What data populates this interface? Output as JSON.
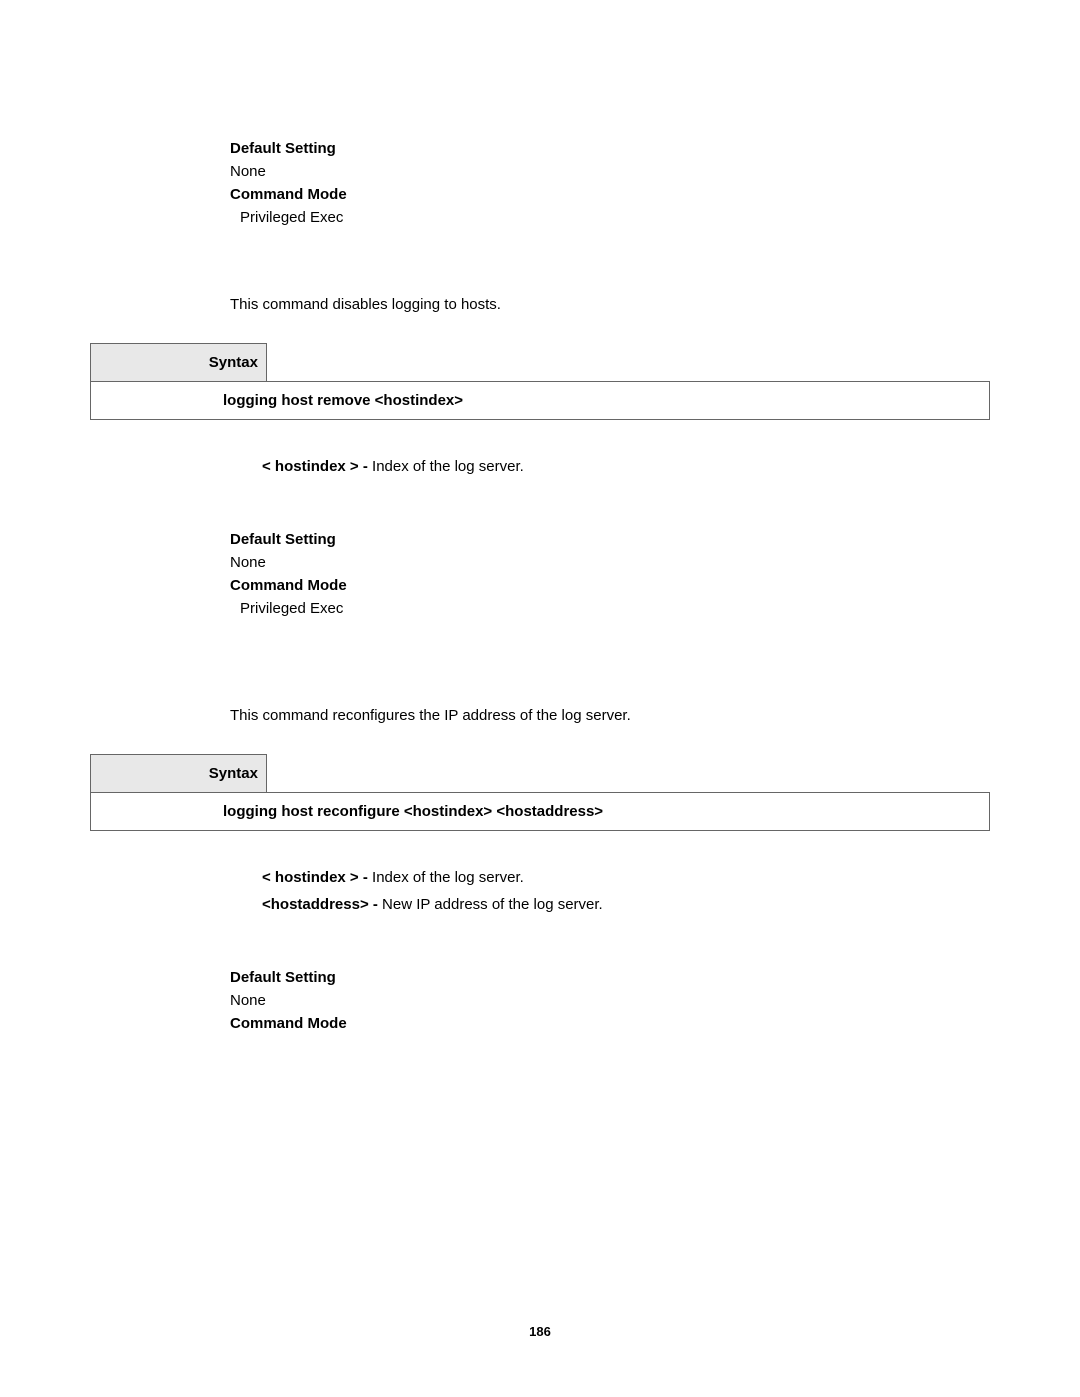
{
  "section1": {
    "default_setting_label": "Default Setting",
    "default_setting_value": "None",
    "command_mode_label": "Command Mode",
    "command_mode_value": "Privileged Exec"
  },
  "section2": {
    "description": "This command disables logging to hosts.",
    "syntax_label": "Syntax",
    "command": "logging host remove <hostindex>",
    "param1_name": "< hostindex > - ",
    "param1_desc": "Index of the log server.",
    "default_setting_label": "Default Setting",
    "default_setting_value": "None",
    "command_mode_label": "Command Mode",
    "command_mode_value": "Privileged Exec"
  },
  "section3": {
    "description": "This command reconfigures the IP address of the log server.",
    "syntax_label": "Syntax",
    "command": "logging host reconfigure <hostindex> <hostaddress>",
    "param1_name": "< hostindex > - ",
    "param1_desc": "Index of the log server.",
    "param2_name": "<hostaddress> - ",
    "param2_desc": "New IP address of the log server.",
    "default_setting_label": "Default Setting",
    "default_setting_value": "None",
    "command_mode_label": "Command Mode"
  },
  "page_number": "186"
}
